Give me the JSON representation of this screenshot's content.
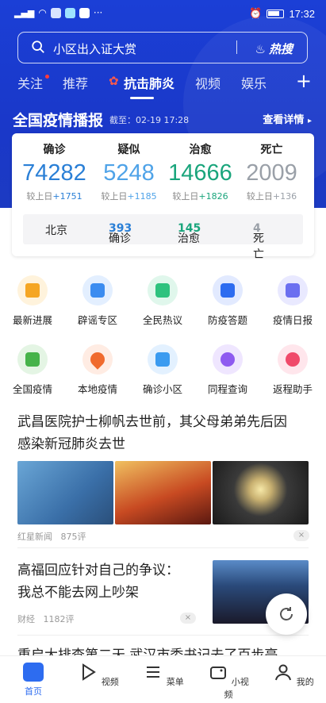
{
  "status": {
    "time": "17:32"
  },
  "search": {
    "query": "小区出入证大赏",
    "hot_label": "热搜"
  },
  "tabs": [
    {
      "label": "关注"
    },
    {
      "label": "推荐"
    },
    {
      "label": "抗击肺炎"
    },
    {
      "label": "视频"
    },
    {
      "label": "娱乐"
    }
  ],
  "report": {
    "title": "全国疫情播报",
    "cutoff": "截至：02-19 17:28",
    "more": "查看详情"
  },
  "stats": [
    {
      "label": "确诊",
      "value": "74282",
      "change_prefix": "较上日",
      "change": "+1751",
      "color": "#2a7fd6"
    },
    {
      "label": "疑似",
      "value": "5248",
      "change_prefix": "较上日",
      "change": "+1185",
      "color": "#4fa3e8"
    },
    {
      "label": "治愈",
      "value": "14666",
      "change_prefix": "较上日",
      "change": "+1826",
      "color": "#1aa57c"
    },
    {
      "label": "死亡",
      "value": "2009",
      "change_prefix": "较上日",
      "change": "+136",
      "color": "#9aa0a8"
    }
  ],
  "city": {
    "name": "北京",
    "confirmed_label": "确诊",
    "confirmed": "393",
    "cured_label": "治愈",
    "cured": "145",
    "dead_label": "死亡",
    "dead": "4"
  },
  "services": [
    {
      "label": "最新进展",
      "icon": "star-icon",
      "color": "#f5a623"
    },
    {
      "label": "辟谣专区",
      "icon": "search-doc-icon",
      "color": "#3b8cf0"
    },
    {
      "label": "全民热议",
      "icon": "chat-icon",
      "color": "#2ec27e"
    },
    {
      "label": "防疫答题",
      "icon": "quiz-icon",
      "color": "#2d6cf0"
    },
    {
      "label": "疫情日报",
      "icon": "calendar-icon",
      "color": "#6b6ff0"
    },
    {
      "label": "全国疫情",
      "icon": "map-icon",
      "color": "#46b34a"
    },
    {
      "label": "本地疫情",
      "icon": "location-pin-icon",
      "color": "#f06a2d"
    },
    {
      "label": "确诊小区",
      "icon": "building-icon",
      "color": "#3b9bf0"
    },
    {
      "label": "同程查询",
      "icon": "transit-icon",
      "color": "#8e5af0"
    },
    {
      "label": "返程助手",
      "icon": "return-icon",
      "color": "#f04a6a"
    }
  ],
  "news": [
    {
      "title_line1": "武昌医院护士柳帆去世前，其父母弟弟先后因",
      "title_line2": "感染新冠肺炎去世",
      "source": "红星新闻",
      "comments": "875评"
    },
    {
      "title_line1": "高福回应针对自己的争议：",
      "title_line2": "我总不能去网上吵架",
      "source": "财经",
      "comments": "1182评"
    },
    {
      "title_line1": "重启大排查第二天 武汉市委书记去了百步亭"
    }
  ],
  "nav": [
    {
      "label": "首页"
    },
    {
      "label": "视频"
    },
    {
      "label": "菜单"
    },
    {
      "label": "小视频"
    },
    {
      "label": "我的"
    }
  ]
}
